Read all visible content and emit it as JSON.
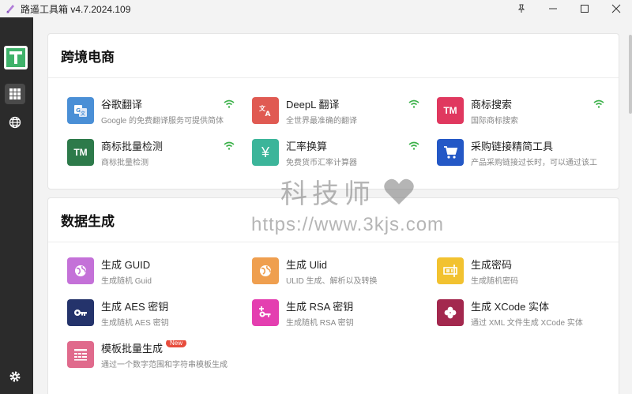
{
  "window": {
    "title": "路遥工具箱 v4.7.2024.109"
  },
  "sidebar": {
    "items": [
      {
        "icon": "apps-grid-icon",
        "active": true
      },
      {
        "icon": "globe-icon",
        "active": false
      }
    ],
    "settings_icon": "gear-icon"
  },
  "sections": [
    {
      "title": "跨境电商",
      "tools": [
        {
          "name": "谷歌翻译",
          "desc": "Google 的免费翻译服务可提供简体",
          "icon": "google-translate-icon",
          "color": "#4a8fd6",
          "online": true
        },
        {
          "name": "DeepL 翻译",
          "desc": "全世界最准确的翻译",
          "icon": "translate-icon",
          "color": "#e05a52",
          "online": true
        },
        {
          "name": "商标搜索",
          "desc": "国际商标搜索",
          "icon_text": "TM",
          "color": "#e0385f",
          "online": true
        },
        {
          "name": "商标批量检测",
          "desc": "商标批量检测",
          "icon_text": "TM",
          "color": "#2d7a4a",
          "online": true
        },
        {
          "name": "汇率换算",
          "desc": "免费货币汇率计算器",
          "icon": "yen-icon",
          "color": "#3cb59a",
          "online": true
        },
        {
          "name": "采购链接精简工具",
          "desc": "产品采购链接过长时，可以通过该工",
          "icon": "cart-icon",
          "color": "#2458c6",
          "online": false
        }
      ]
    },
    {
      "title": "数据生成",
      "tools": [
        {
          "name": "生成 GUID",
          "desc": "生成随机 Guid",
          "icon": "globe-icon",
          "color": "#c471d8"
        },
        {
          "name": "生成 Ulid",
          "desc": "ULID 生成、解析以及转换",
          "icon": "globe-icon",
          "color": "#ef9f4f"
        },
        {
          "name": "生成密码",
          "desc": "生成随机密码",
          "icon": "password-icon",
          "color": "#f2c230"
        },
        {
          "name": "生成 AES 密钥",
          "desc": "生成随机 AES 密钥",
          "icon": "key-icon",
          "color": "#24336b"
        },
        {
          "name": "生成 RSA 密钥",
          "desc": "生成随机 RSA 密钥",
          "icon": "key-plus-icon",
          "color": "#e43fb0"
        },
        {
          "name": "生成 XCode 实体",
          "desc": "通过 XML 文件生成 XCode 实体",
          "icon": "clover-icon",
          "color": "#a3284e"
        },
        {
          "name": "模板批量生成",
          "desc": "通过一个数字范围和字符串模板生成",
          "icon": "template-icon",
          "color": "#e06a8c",
          "badge": "New"
        }
      ]
    }
  ],
  "watermark": {
    "line1": "科技师",
    "line2": "https://www.3kjs.com"
  }
}
